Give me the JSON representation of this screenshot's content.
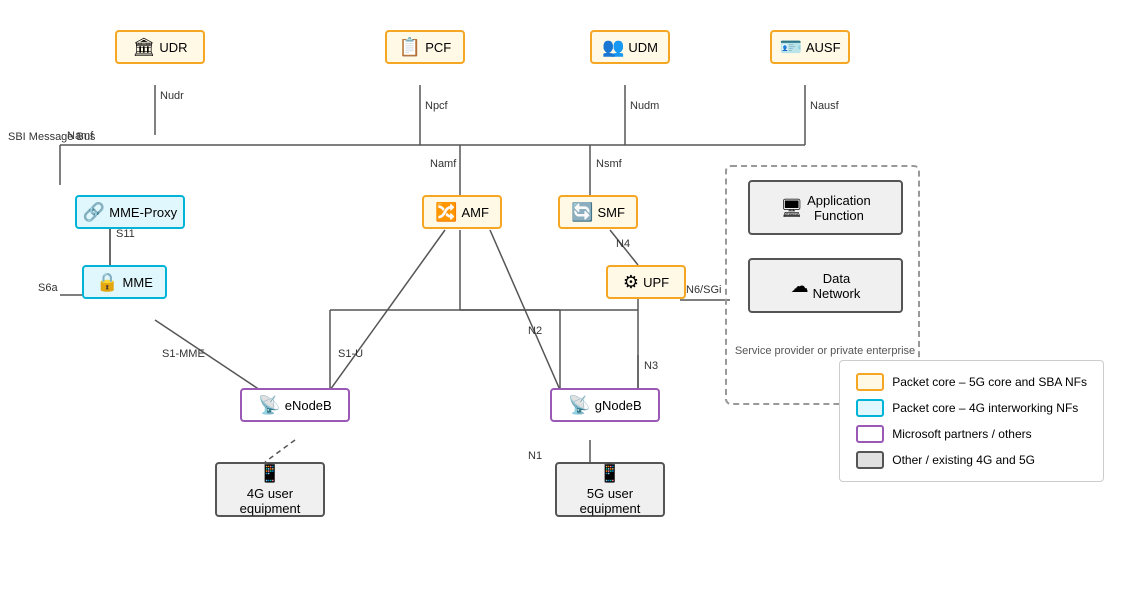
{
  "nodes": {
    "udr": {
      "label": "UDR",
      "type": "yellow",
      "icon": "🏛"
    },
    "pcf": {
      "label": "PCF",
      "type": "yellow",
      "icon": "📋"
    },
    "udm": {
      "label": "UDM",
      "type": "yellow",
      "icon": "👥"
    },
    "ausf": {
      "label": "AUSF",
      "type": "yellow",
      "icon": "🪪"
    },
    "amf": {
      "label": "AMF",
      "type": "yellow",
      "icon": "🔀"
    },
    "smf": {
      "label": "SMF",
      "type": "yellow",
      "icon": "🔄"
    },
    "upf": {
      "label": "UPF",
      "type": "yellow",
      "icon": "⚙"
    },
    "mme_proxy": {
      "label": "MME-Proxy",
      "type": "cyan",
      "icon": "🔗"
    },
    "mme": {
      "label": "MME",
      "type": "cyan",
      "icon": "🔒"
    },
    "enodeb": {
      "label": "eNodeB",
      "type": "purple",
      "icon": "📡"
    },
    "gnodeb": {
      "label": "gNodeB",
      "type": "purple",
      "icon": "📡"
    },
    "ue4g": {
      "label": "4G user\nequipment",
      "type": "dark",
      "icon": "📱"
    },
    "ue5g": {
      "label": "5G user\nequipment",
      "type": "dark",
      "icon": "📱"
    },
    "af": {
      "label": "Application\nFunction",
      "type": "dark",
      "icon": "🖥"
    },
    "dn": {
      "label": "Data\nNetwork",
      "type": "dark",
      "icon": "☁"
    }
  },
  "connLabels": {
    "nudr": "Nudr",
    "npcf": "Npcf",
    "nudm": "Nudm",
    "nausf": "Nausf",
    "namf_udr": "Namf",
    "namf_pcf": "Namf",
    "nsmf": "Nsmf",
    "sbi": "SBI Message\nBus",
    "s11": "S11",
    "s6a": "S6a",
    "s1mme": "S1-MME",
    "s1u": "S1-U",
    "n4": "N4",
    "n2": "N2",
    "n3": "N3",
    "n1": "N1",
    "n6sgi": "N6/SGi",
    "sp_label": "Service provider or\nprivate enterprise"
  },
  "legend": {
    "items": [
      {
        "color": "yellow",
        "text": "Packet core – 5G core and SBA NFs"
      },
      {
        "color": "cyan",
        "text": "Packet core – 4G interworking NFs"
      },
      {
        "color": "purple",
        "text": "Microsoft partners / others"
      },
      {
        "color": "dark",
        "text": "Other / existing 4G and 5G"
      }
    ]
  }
}
